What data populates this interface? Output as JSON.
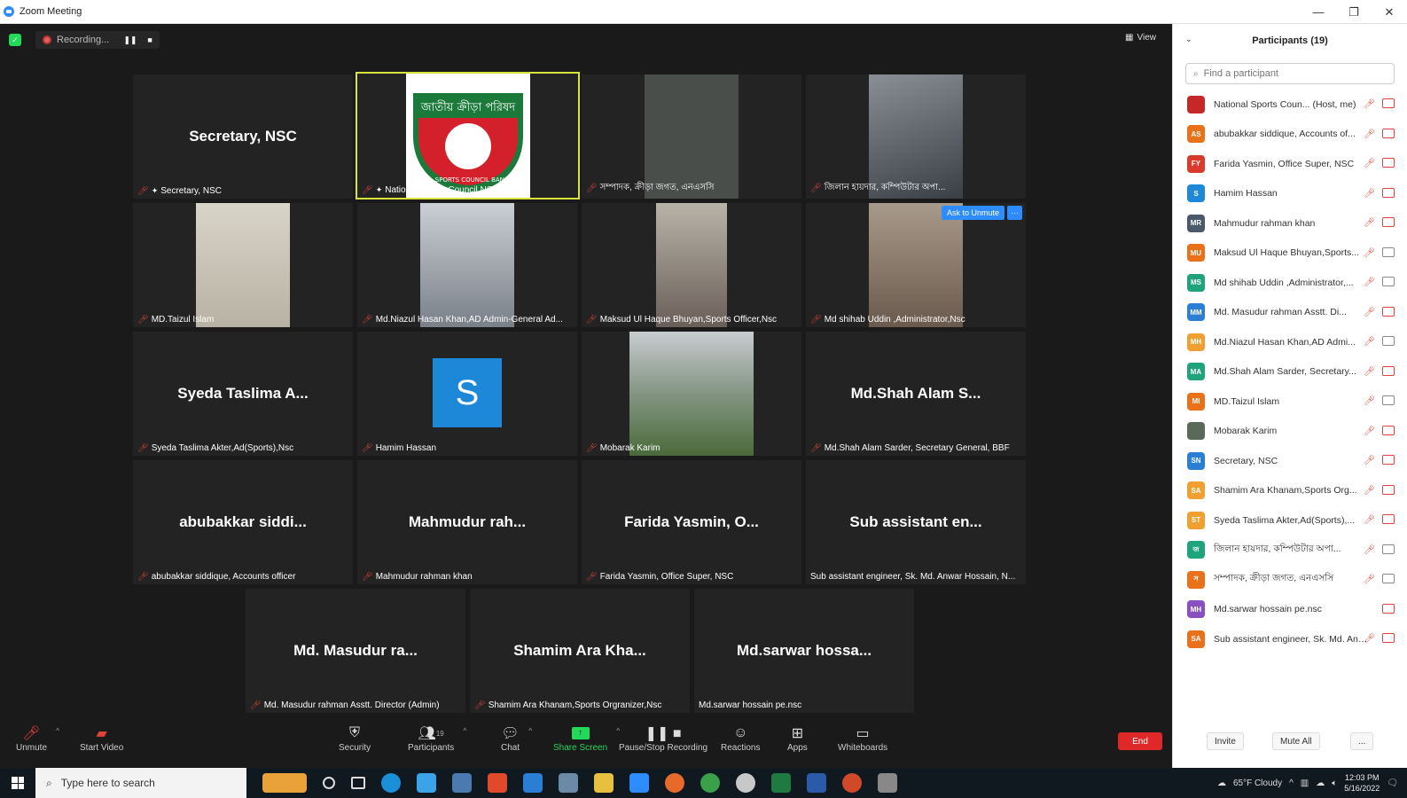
{
  "window": {
    "title": "Zoom Meeting"
  },
  "topbar": {
    "recording_label": "Recording...",
    "view_label": "View"
  },
  "tiles": [
    {
      "big": "Secretary, NSC",
      "label": "Secretary, NSC"
    },
    {
      "big": "",
      "label": "National Sports Council NSC",
      "logo_text_top": "জাতীয় ক্রীড়া পরিষদ",
      "logo_text_bottom": "NATIONAL SPORTS COUNCIL BANGLADESH"
    },
    {
      "big": "",
      "label": "সম্পাদক, ক্রীড়া জগত, এনএসসি"
    },
    {
      "big": "",
      "label": "জিলান হায়দার, কম্পিউটার অপা..."
    },
    {
      "big": "",
      "label": "MD.Taizul Islam"
    },
    {
      "big": "",
      "label": "Md.Niazul Hasan Khan,AD Admin-General Ad..."
    },
    {
      "big": "",
      "label": "Maksud Ul Haque Bhuyan,Sports Officer,Nsc"
    },
    {
      "big": "",
      "label": "Md shihab Uddin ,Administrator,Nsc",
      "ask_unmute": "Ask to Unmute",
      "more": "···"
    },
    {
      "big": "Syeda Taslima A...",
      "label": "Syeda Taslima Akter,Ad(Sports),Nsc"
    },
    {
      "big": "",
      "label": "Hamim Hassan",
      "avatar_letter": "S"
    },
    {
      "big": "",
      "label": "Mobarak Karim"
    },
    {
      "big": "Md.Shah Alam S...",
      "label": "Md.Shah Alam Sarder, Secretary General, BBF"
    },
    {
      "big": "abubakkar siddi...",
      "label": "abubakkar siddique, Accounts officer"
    },
    {
      "big": "Mahmudur rah...",
      "label": "Mahmudur rahman khan"
    },
    {
      "big": "Farida Yasmin, O...",
      "label": "Farida Yasmin, Office Super, NSC"
    },
    {
      "big": "Sub assistant en...",
      "label": "Sub assistant engineer, Sk. Md. Anwar Hossain, N..."
    },
    {
      "big": "Md. Masudur ra...",
      "label": "Md. Masudur rahman    Asstt. Director (Admin)"
    },
    {
      "big": "Shamim Ara Kha...",
      "label": "Shamim Ara Khanam,Sports Orgranizer,Nsc"
    },
    {
      "big": "Md.sarwar hossa...",
      "label": "Md.sarwar hossain pe.nsc"
    }
  ],
  "toolbar": {
    "unmute": "Unmute",
    "start_video": "Start Video",
    "security": "Security",
    "participants": "Participants",
    "participants_count": "19",
    "chat": "Chat",
    "share_screen": "Share Screen",
    "pause_recording": "Pause/Stop Recording",
    "reactions": "Reactions",
    "apps": "Apps",
    "whiteboards": "Whiteboards",
    "end": "End"
  },
  "panel": {
    "title": "Participants (19)",
    "search_placeholder": "Find a participant",
    "invite": "Invite",
    "mute_all": "Mute All",
    "more": "...",
    "participants": [
      {
        "initials": "",
        "color": "#c62828",
        "name": "National Sports Coun... (Host, me)",
        "video": "off"
      },
      {
        "initials": "AS",
        "color": "#e8711a",
        "name": "abubakkar siddique, Accounts of...",
        "video": "off"
      },
      {
        "initials": "FY",
        "color": "#d93a2b",
        "name": "Farida Yasmin, Office Super, NSC",
        "video": "off"
      },
      {
        "initials": "S",
        "color": "#1e88d8",
        "name": "Hamim Hassan",
        "video": "off"
      },
      {
        "initials": "MR",
        "color": "#4a5a6a",
        "name": "Mahmudur rahman khan",
        "video": "off"
      },
      {
        "initials": "MU",
        "color": "#e8711a",
        "name": "Maksud Ul Haque Bhuyan,Sports...",
        "video": "on"
      },
      {
        "initials": "MS",
        "color": "#1fa37a",
        "name": "Md shihab Uddin ,Administrator,...",
        "video": "on"
      },
      {
        "initials": "MM",
        "color": "#2a7fd4",
        "name": "Md. Masudur rahman    Asstt. Di...",
        "video": "off"
      },
      {
        "initials": "MH",
        "color": "#f0a030",
        "name": "Md.Niazul Hasan Khan,AD Admi...",
        "video": "on"
      },
      {
        "initials": "MA",
        "color": "#1fa37a",
        "name": "Md.Shah Alam Sarder, Secretary...",
        "video": "off"
      },
      {
        "initials": "MI",
        "color": "#e8711a",
        "name": "MD.Taizul Islam",
        "video": "on"
      },
      {
        "initials": "",
        "color": "#5a6a5a",
        "name": "Mobarak Karim",
        "video": "off"
      },
      {
        "initials": "SN",
        "color": "#2a7fd4",
        "name": "Secretary, NSC",
        "video": "off"
      },
      {
        "initials": "SA",
        "color": "#f0a030",
        "name": "Shamim Ara Khanam,Sports Org...",
        "video": "off"
      },
      {
        "initials": "ST",
        "color": "#f0a030",
        "name": "Syeda Taslima Akter,Ad(Sports),...",
        "video": "off"
      },
      {
        "initials": "জ",
        "color": "#1fa37a",
        "name": "জিলান হায়দার, কম্পিউটার অপা...",
        "video": "on"
      },
      {
        "initials": "স",
        "color": "#e8711a",
        "name": "সম্পাদক, ক্রীড়া জগত, এনএসসি",
        "video": "on"
      },
      {
        "initials": "MH",
        "color": "#8a4fc0",
        "name": "Md.sarwar hossain pe.nsc",
        "video": "off",
        "nomic": true
      },
      {
        "initials": "SA",
        "color": "#e8711a",
        "name": "Sub assistant engineer, Sk. Md. Anw...",
        "video": "off"
      }
    ]
  },
  "taskbar": {
    "search_placeholder": "Type here to search",
    "weather": "65°F  Cloudy",
    "time": "12:03 PM",
    "date": "5/16/2022"
  }
}
